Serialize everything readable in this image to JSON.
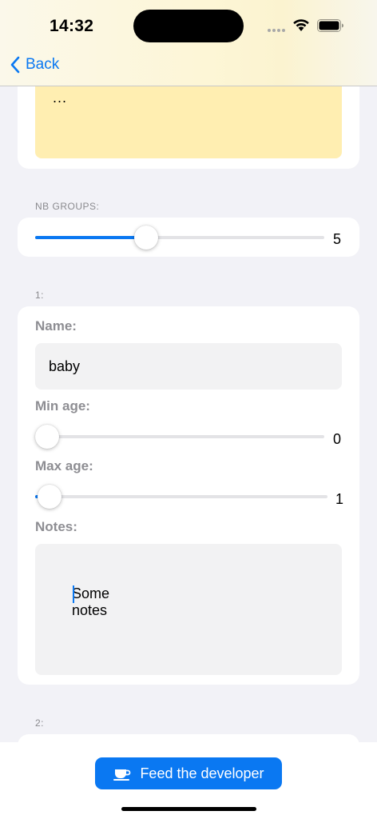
{
  "status_bar": {
    "time": "14:32"
  },
  "nav": {
    "back_label": "Back"
  },
  "top_note": {
    "text": "..."
  },
  "nb_groups": {
    "label": "NB GROUPS:",
    "value": "5",
    "level": 0.4
  },
  "group1": {
    "header": "1:",
    "name_label": "Name:",
    "name_value": "baby",
    "min_age_label": "Min age:",
    "min_age_value": "0",
    "min_age_level": 0.0,
    "max_age_label": "Max age:",
    "max_age_value": "1",
    "max_age_level": 0.02,
    "notes_label": "Notes:",
    "notes_value": "Some notes"
  },
  "group2": {
    "header": "2:"
  },
  "bottom": {
    "feed_button_label": "Feed the developer"
  },
  "colors": {
    "accent": "#0a78f2",
    "note_yellow": "#ffeeb1",
    "background": "#f2f2f7"
  },
  "icons": {
    "back": "chevron-left-icon",
    "feed": "coffee-cup-icon",
    "wifi": "wifi-icon",
    "battery": "battery-icon"
  }
}
